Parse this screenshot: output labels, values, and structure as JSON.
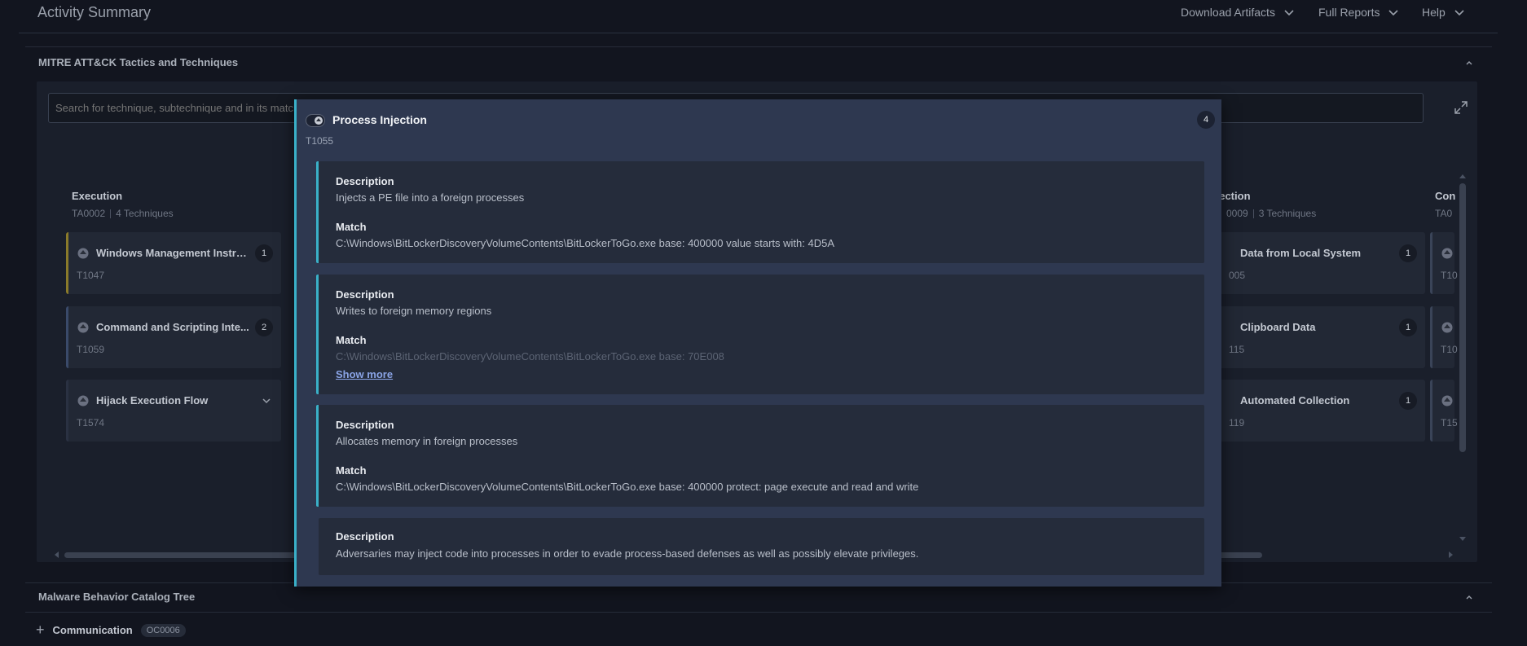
{
  "header": {
    "title": "Activity Summary",
    "nav": [
      {
        "label": "Download Artifacts"
      },
      {
        "label": "Full Reports"
      },
      {
        "label": "Help"
      }
    ]
  },
  "mitre": {
    "title": "MITRE ATT&CK Tactics and Techniques",
    "search_placeholder": "Search for technique, subtechnique and in its matches",
    "columns": [
      {
        "name": "Execution",
        "id": "TA0002",
        "count": "4 Techniques",
        "techniques": [
          {
            "name": "Windows Management Instru...",
            "id": "T1047",
            "badge": "1",
            "accent": "#8a7a2a"
          },
          {
            "name": "Command and Scripting Inte...",
            "id": "T1059",
            "badge": "2",
            "accent": "#3a4a6a"
          },
          {
            "name": "Hijack Execution Flow",
            "id": "T1574",
            "badge": "",
            "accent": "#2a3142"
          }
        ]
      },
      {
        "name": "llection",
        "id": "0009",
        "count": "3 Techniques",
        "techniques": [
          {
            "name": "Data from Local System",
            "id": "005",
            "badge": "1"
          },
          {
            "name": "Clipboard Data",
            "id": "115",
            "badge": "1"
          },
          {
            "name": "Automated Collection",
            "id": "119",
            "badge": "1"
          }
        ]
      },
      {
        "name": "Con",
        "id": "TA0",
        "techniques": [
          {
            "id": "T10"
          },
          {
            "id": "T10"
          },
          {
            "id": "T15"
          }
        ]
      }
    ]
  },
  "popup": {
    "title": "Process Injection",
    "id": "T1055",
    "badge": "4",
    "entries": [
      {
        "desc_label": "Description",
        "desc": "Injects a PE file into a foreign processes",
        "match_label": "Match",
        "match": "C:\\Windows\\BitLockerDiscoveryVolumeContents\\BitLockerToGo.exe base: 400000 value starts with: 4D5A"
      },
      {
        "desc_label": "Description",
        "desc": "Writes to foreign memory regions",
        "match_label": "Match",
        "match": "C:\\Windows\\BitLockerDiscoveryVolumeContents\\BitLockerToGo.exe base: 70E008",
        "show_more": "Show more"
      },
      {
        "desc_label": "Description",
        "desc": "Allocates memory in foreign processes",
        "match_label": "Match",
        "match": "C:\\Windows\\BitLockerDiscoveryVolumeContents\\BitLockerToGo.exe base: 400000 protect: page execute and read and write"
      },
      {
        "desc_label": "Description",
        "desc": "Adversaries may inject code into processes in order to evade process-based defenses as well as possibly elevate privileges."
      }
    ]
  },
  "mbc": {
    "title": "Malware Behavior Catalog Tree",
    "item": {
      "label": "Communication",
      "tag": "OC0006"
    }
  },
  "colors": {
    "background": "#12151f",
    "panel": "#1a1f2b",
    "popup": "#2e3850",
    "accent": "#3ab0c8",
    "link": "#8aa4e6"
  },
  "icons": {
    "nav_dropdown": "chevron-down-icon",
    "section_toggle": "chevron-up-icon",
    "expand": "expand-icon",
    "technique": "technique-icon"
  }
}
